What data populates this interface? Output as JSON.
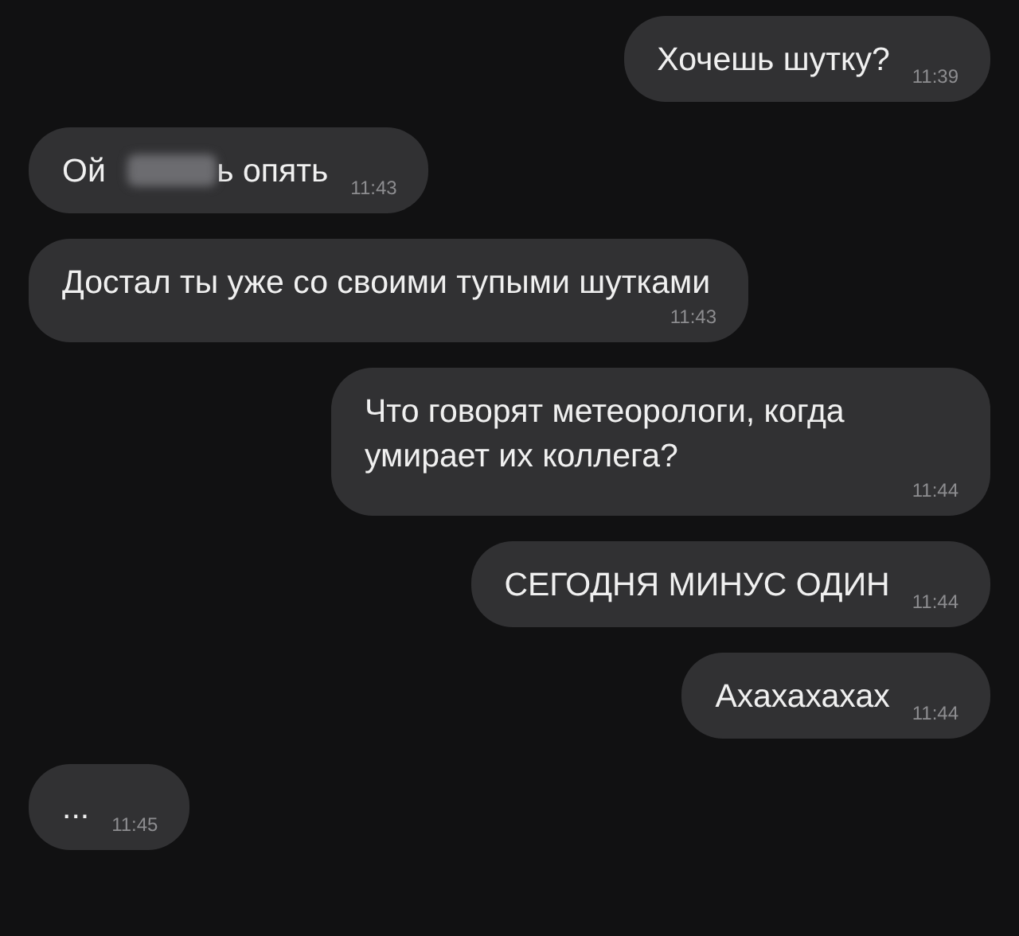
{
  "messages": [
    {
      "kind": "outgoing",
      "parts": [
        {
          "kind": "text",
          "text": "Хочешь шутку?"
        }
      ],
      "time": "11:39"
    },
    {
      "kind": "incoming",
      "parts": [
        {
          "kind": "text",
          "text": "Ой"
        },
        {
          "kind": "redacted"
        },
        {
          "kind": "text",
          "text": "ь опять"
        }
      ],
      "time": "11:43"
    },
    {
      "kind": "incoming",
      "parts": [
        {
          "kind": "text",
          "text": "Достал ты уже со своими тупыми шутками"
        }
      ],
      "time": "11:43"
    },
    {
      "kind": "outgoing",
      "parts": [
        {
          "kind": "text",
          "text": "Что говорят метеорологи, когда умирает их коллега?"
        }
      ],
      "time": "11:44"
    },
    {
      "kind": "outgoing",
      "parts": [
        {
          "kind": "text",
          "text": "СЕГОДНЯ МИНУС ОДИН"
        }
      ],
      "time": "11:44"
    },
    {
      "kind": "outgoing",
      "parts": [
        {
          "kind": "text",
          "text": "Ахахахахах"
        }
      ],
      "time": "11:44"
    },
    {
      "kind": "incoming",
      "parts": [
        {
          "kind": "text",
          "text": "..."
        }
      ],
      "time": "11:45"
    }
  ]
}
